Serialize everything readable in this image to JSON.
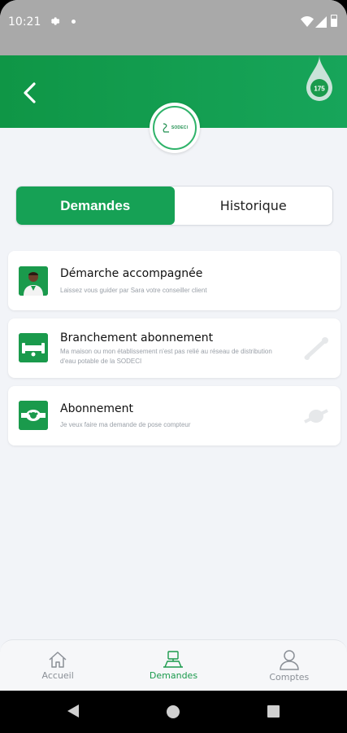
{
  "status_bar": {
    "time": "10:21"
  },
  "header": {
    "badge_text": "175",
    "logo_text": "SODECI"
  },
  "tabs": [
    {
      "label": "Demandes",
      "active": true
    },
    {
      "label": "Historique",
      "active": false
    }
  ],
  "cards": [
    {
      "title": "Démarche accompagnée",
      "description": "Laissez vous guider par Sara votre conseiller client",
      "icon": "advisor-avatar-icon"
    },
    {
      "title": "Branchement abonnement",
      "description": "Ma maison ou mon établissement  n'est pas relié au réseau de distribution d'eau potable de la SODECI",
      "icon": "pipe-connection-icon"
    },
    {
      "title": "Abonnement",
      "description": "Je veux faire ma demande de pose compteur",
      "icon": "water-meter-icon"
    }
  ],
  "bottom_nav": [
    {
      "label": "Accueil",
      "icon": "home-icon",
      "active": false
    },
    {
      "label": "Demandes",
      "icon": "requests-icon",
      "active": true
    },
    {
      "label": "Comptes",
      "icon": "user-icon",
      "active": false
    }
  ],
  "colors": {
    "brand_green": "#16a155",
    "background": "#f2f4f8",
    "status_bar": "#a9a9a9"
  }
}
